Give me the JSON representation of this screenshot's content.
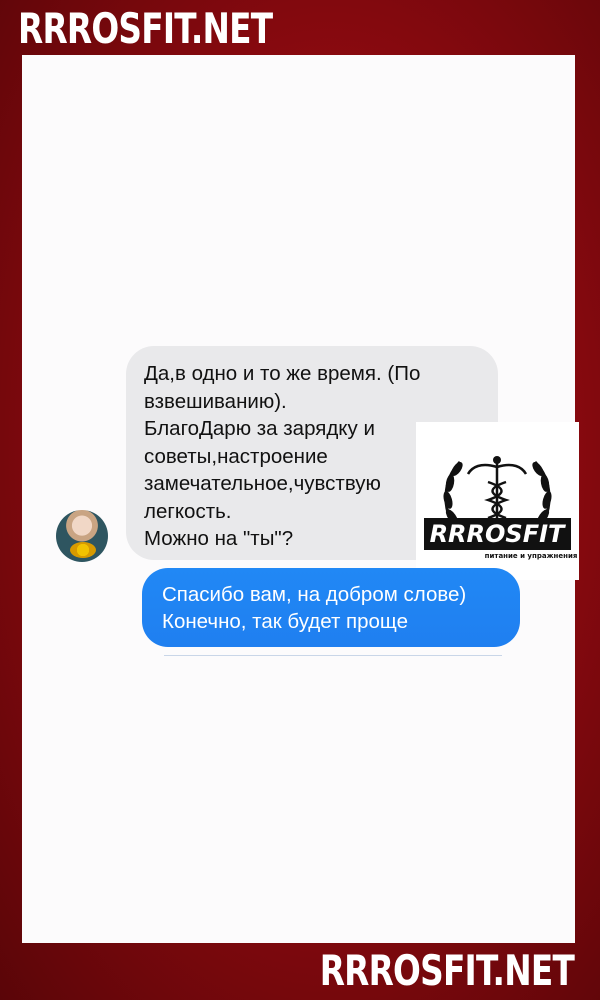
{
  "watermark": {
    "top_text": "RRROSFIT.NET",
    "bottom_text": "RRROSFIT.NET"
  },
  "chat": {
    "incoming": {
      "lines": [
        "Да,в одно и то же время. (По",
        "взвешиванию).",
        "БлагоДарю за зарядку и",
        "советы,настроение",
        "замечательное,чувствую",
        "легкость.",
        "Можно на \"ты\"?"
      ]
    },
    "outgoing": {
      "lines": [
        "Спасибо вам, на добром слове)",
        "Конечно, так будет проще"
      ]
    }
  },
  "logo": {
    "name": "RRROSFIT",
    "tagline": "питание и упражнения"
  },
  "colors": {
    "border_red": "#a30b12",
    "incoming_bubble": "#e9e9eb",
    "outgoing_bubble": "#2083f2"
  }
}
